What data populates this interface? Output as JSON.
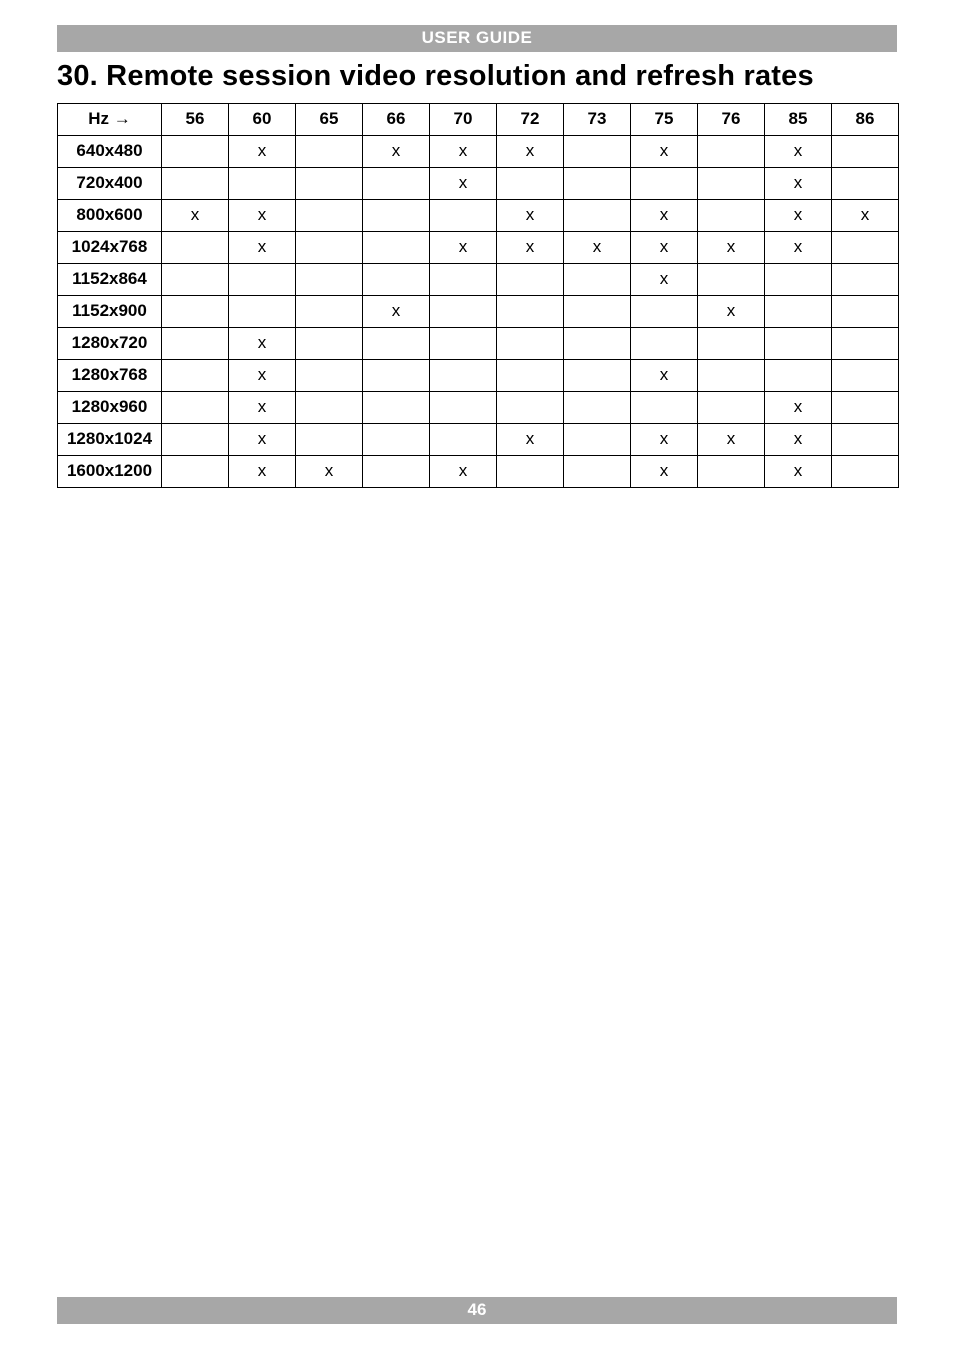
{
  "banner_top": "USER GUIDE",
  "heading": "30. Remote session video resolution and refresh rates",
  "hz_label": "Hz →",
  "columns": [
    "56",
    "60",
    "65",
    "66",
    "70",
    "72",
    "73",
    "75",
    "76",
    "85",
    "86"
  ],
  "rows": [
    {
      "label": "640x480",
      "cells": [
        "",
        "x",
        "",
        "x",
        "x",
        "x",
        "",
        "x",
        "",
        "x",
        ""
      ]
    },
    {
      "label": "720x400",
      "cells": [
        "",
        "",
        "",
        "",
        "x",
        "",
        "",
        "",
        "",
        "x",
        ""
      ]
    },
    {
      "label": "800x600",
      "cells": [
        "x",
        "x",
        "",
        "",
        "",
        "x",
        "",
        "x",
        "",
        "x",
        "x"
      ]
    },
    {
      "label": "1024x768",
      "cells": [
        "",
        "x",
        "",
        "",
        "x",
        "x",
        "x",
        "x",
        "x",
        "x",
        ""
      ]
    },
    {
      "label": "1152x864",
      "cells": [
        "",
        "",
        "",
        "",
        "",
        "",
        "",
        "x",
        "",
        "",
        ""
      ]
    },
    {
      "label": "1152x900",
      "cells": [
        "",
        "",
        "",
        "x",
        "",
        "",
        "",
        "",
        "x",
        "",
        ""
      ]
    },
    {
      "label": "1280x720",
      "cells": [
        "",
        "x",
        "",
        "",
        "",
        "",
        "",
        "",
        "",
        "",
        ""
      ]
    },
    {
      "label": "1280x768",
      "cells": [
        "",
        "x",
        "",
        "",
        "",
        "",
        "",
        "x",
        "",
        "",
        ""
      ]
    },
    {
      "label": "1280x960",
      "cells": [
        "",
        "x",
        "",
        "",
        "",
        "",
        "",
        "",
        "",
        "x",
        ""
      ]
    },
    {
      "label": "1280x1024",
      "cells": [
        "",
        "x",
        "",
        "",
        "",
        "x",
        "",
        "x",
        "x",
        "x",
        ""
      ]
    },
    {
      "label": "1600x1200",
      "cells": [
        "",
        "x",
        "x",
        "",
        "x",
        "",
        "",
        "x",
        "",
        "x",
        ""
      ]
    }
  ],
  "page_number": "46",
  "chart_data": {
    "type": "table",
    "title": "Remote session video resolution and refresh rates",
    "xlabel": "Hz",
    "ylabel": "Resolution",
    "columns": [
      "56",
      "60",
      "65",
      "66",
      "70",
      "72",
      "73",
      "75",
      "76",
      "85",
      "86"
    ],
    "rows": [
      "640x480",
      "720x400",
      "800x600",
      "1024x768",
      "1152x864",
      "1152x900",
      "1280x720",
      "1280x768",
      "1280x960",
      "1280x1024",
      "1600x1200"
    ],
    "values": [
      [
        0,
        1,
        0,
        1,
        1,
        1,
        0,
        1,
        0,
        1,
        0
      ],
      [
        0,
        0,
        0,
        0,
        1,
        0,
        0,
        0,
        0,
        1,
        0
      ],
      [
        1,
        1,
        0,
        0,
        0,
        1,
        0,
        1,
        0,
        1,
        1
      ],
      [
        0,
        1,
        0,
        0,
        1,
        1,
        1,
        1,
        1,
        1,
        0
      ],
      [
        0,
        0,
        0,
        0,
        0,
        0,
        0,
        1,
        0,
        0,
        0
      ],
      [
        0,
        0,
        0,
        1,
        0,
        0,
        0,
        0,
        1,
        0,
        0
      ],
      [
        0,
        1,
        0,
        0,
        0,
        0,
        0,
        0,
        0,
        0,
        0
      ],
      [
        0,
        1,
        0,
        0,
        0,
        0,
        0,
        1,
        0,
        0,
        0
      ],
      [
        0,
        1,
        0,
        0,
        0,
        0,
        0,
        0,
        0,
        1,
        0
      ],
      [
        0,
        1,
        0,
        0,
        0,
        1,
        0,
        1,
        1,
        1,
        0
      ],
      [
        0,
        1,
        1,
        0,
        1,
        0,
        0,
        1,
        0,
        1,
        0
      ]
    ]
  }
}
